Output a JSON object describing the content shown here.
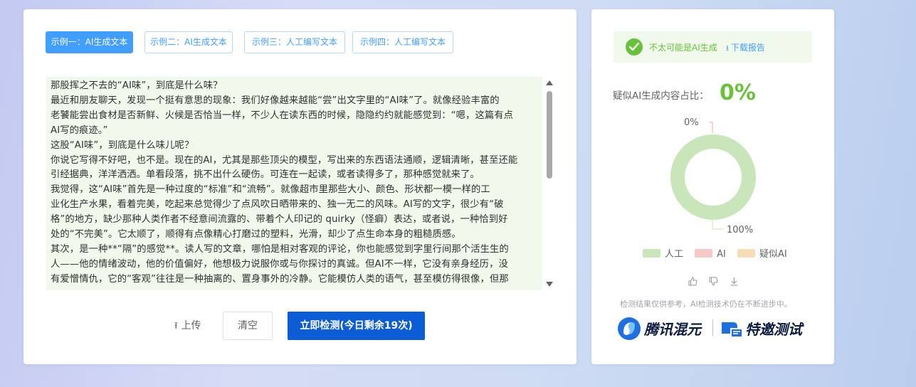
{
  "tabs": [
    {
      "label": "示例一：AI生成文本",
      "active": true
    },
    {
      "label": "示例二：AI生成文本",
      "active": false
    },
    {
      "label": "示例三：人工编写文本",
      "active": false
    },
    {
      "label": "示例四：人工编写文本",
      "active": false
    }
  ],
  "text_lines": [
    "那股挥之不去的“AI味”，到底是什么味？",
    "最近和朋友聊天，发现一个挺有意思的现象：我们好像越来越能“尝”出文字里的“AI味”了。就像经验丰富的",
    "老饕能尝出食材是否新鲜、火候是否恰当一样，不少人在读东西的时候，隐隐约约就能感觉到：“嗯，这篇有点",
    "AI写的痕迹。”",
    "这股“AI味”，到底是什么味儿呢？",
    "你说它写得不好吧，也不是。现在的AI，尤其是那些顶尖的模型，写出来的东西语法通顺，逻辑清晰，甚至还能",
    "引经据典，洋洋洒洒。单看段落，挑不出什么硬伤。可连在一起读，或者读得多了，那种感觉就来了。",
    "我觉得，这“AI味”首先是一种过度的“标准”和“流畅”。就像超市里那些大小、颜色、形状都一模一样的工",
    "业化生产水果，看着完美，吃起来总觉得少了点风吹日晒带来的、独一无二的风味。AI写的文字，很少有“破",
    "格”的地方，缺少那种人类作者不经意间流露的、带着个人印记的 quirky（怪癖）表达，或者说，一种恰到好",
    "处的“不完美”。它太顺了，顺得有点像精心打磨过的塑料，光滑，却少了点生命本身的粗糙质感。",
    "其次，是一种**“隔”的感觉**。读人写的文章，哪怕是相对客观的评论，你也能感觉到字里行间那个活生生的",
    "人——他的情绪波动，他的价值偏好，他想极力说服你或与你探讨的真诚。但AI不一样，它没有亲身经历，没",
    "有爱憎情仇，它的“客观”往往是一种抽离的、置身事外的冷静。它能模仿人类的语气，甚至模仿得很像，但那"
  ],
  "buttons": {
    "upload": "上传",
    "clear": "清空",
    "detect": "立即检测(今日剩余19次)"
  },
  "result": {
    "verdict": "不太可能是AI生成",
    "download": "下载报告",
    "ratio_label": "疑似AI生成内容占比：",
    "ratio_value": "0%"
  },
  "chart_data": {
    "type": "pie",
    "variant": "donut",
    "series": [
      {
        "name": "人工",
        "value": 100,
        "color": "#c8e6b9"
      },
      {
        "name": "AI",
        "value": 0,
        "color": "#f8c8c8"
      },
      {
        "name": "疑似AI",
        "value": 0,
        "color": "#f7dcb8"
      }
    ],
    "labels": {
      "top": "0%",
      "bottom": "100%"
    }
  },
  "legend": [
    {
      "label": "人工",
      "color": "#c8e6b9"
    },
    {
      "label": "AI",
      "color": "#f8c8c8"
    },
    {
      "label": "疑似AI",
      "color": "#f7dcb8"
    }
  ],
  "disclaimer": "检测结果仅供参考，AI检测技术仍在不断进步中。",
  "brand": {
    "name": "腾讯混元",
    "sub": "特邀测试"
  }
}
